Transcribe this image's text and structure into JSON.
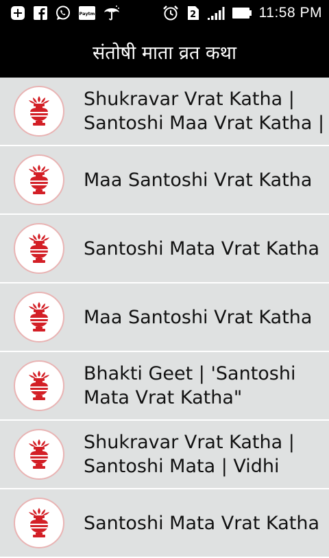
{
  "statusbar": {
    "time": "11:58 PM",
    "sim_badge": "2",
    "paytm_label": "Paytm",
    "left_icons": [
      "notification-plus-icon",
      "facebook-icon",
      "whatsapp-icon",
      "paytm-icon",
      "umbrella-icon"
    ],
    "right_icons": [
      "alarm-icon",
      "sim-2-icon",
      "signal-icon",
      "battery-icon"
    ]
  },
  "app": {
    "title": "संतोषी माता व्रत कथा"
  },
  "items": [
    {
      "label": "Shukravar Vrat Katha |\nSantoshi Maa Vrat Katha |"
    },
    {
      "label": "Maa Santoshi Vrat Katha"
    },
    {
      "label": "Santoshi Mata Vrat Katha"
    },
    {
      "label": "Maa Santoshi Vrat Katha"
    },
    {
      "label": "Bhakti Geet | 'Santoshi\nMata Vrat Katha\""
    },
    {
      "label": "Shukravar Vrat Katha |\nSantoshi Mata | Vidhi"
    },
    {
      "label": "Santoshi Mata Vrat Katha"
    }
  ],
  "colors": {
    "accent": "#d31f26",
    "header_bg": "#000000",
    "row_bg": "#dfe1e1",
    "divider": "#ffffff"
  }
}
